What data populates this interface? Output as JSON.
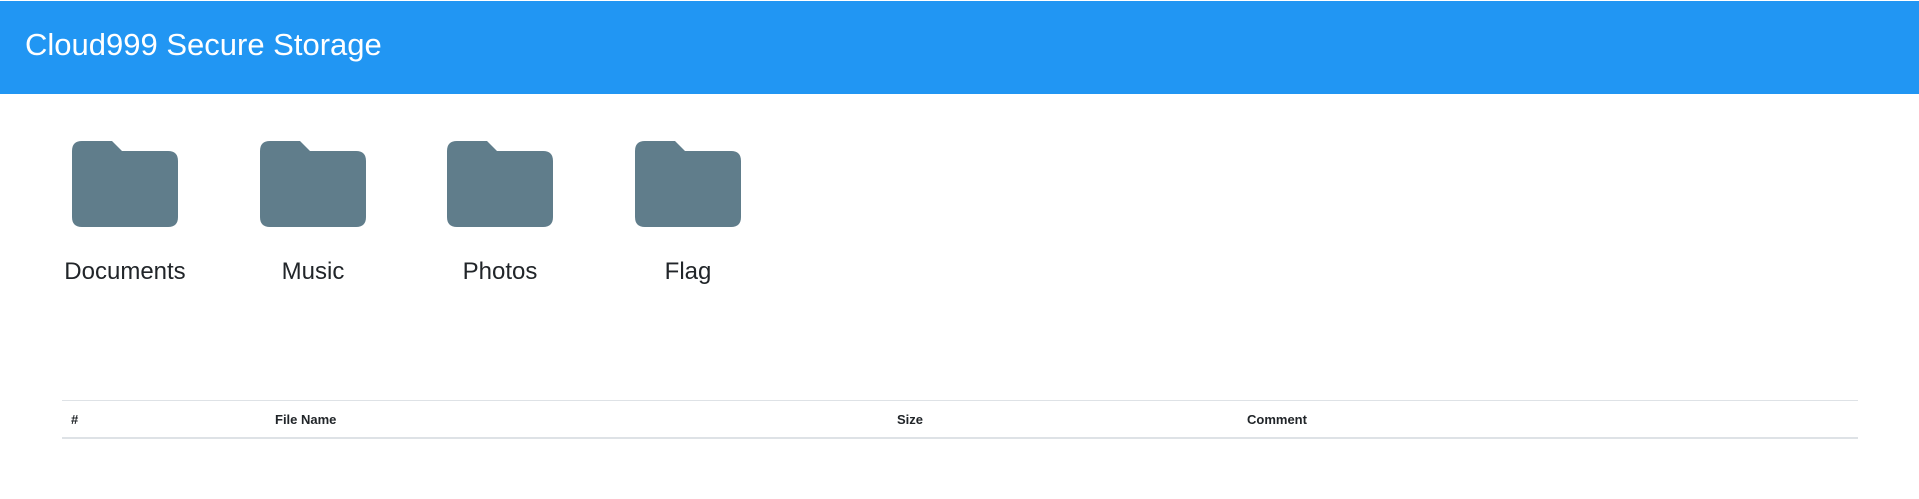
{
  "header": {
    "title": "Cloud999 Secure Storage",
    "background_color": "#2196f3"
  },
  "folders": [
    {
      "label": "Documents",
      "icon": "folder-icon",
      "color": "#607d8b"
    },
    {
      "label": "Music",
      "icon": "folder-icon",
      "color": "#607d8b"
    },
    {
      "label": "Photos",
      "icon": "folder-icon",
      "color": "#607d8b"
    },
    {
      "label": "Flag",
      "icon": "folder-icon",
      "color": "#607d8b"
    }
  ],
  "file_table": {
    "columns": [
      "#",
      "File Name",
      "Size",
      "Comment"
    ],
    "rows": []
  }
}
